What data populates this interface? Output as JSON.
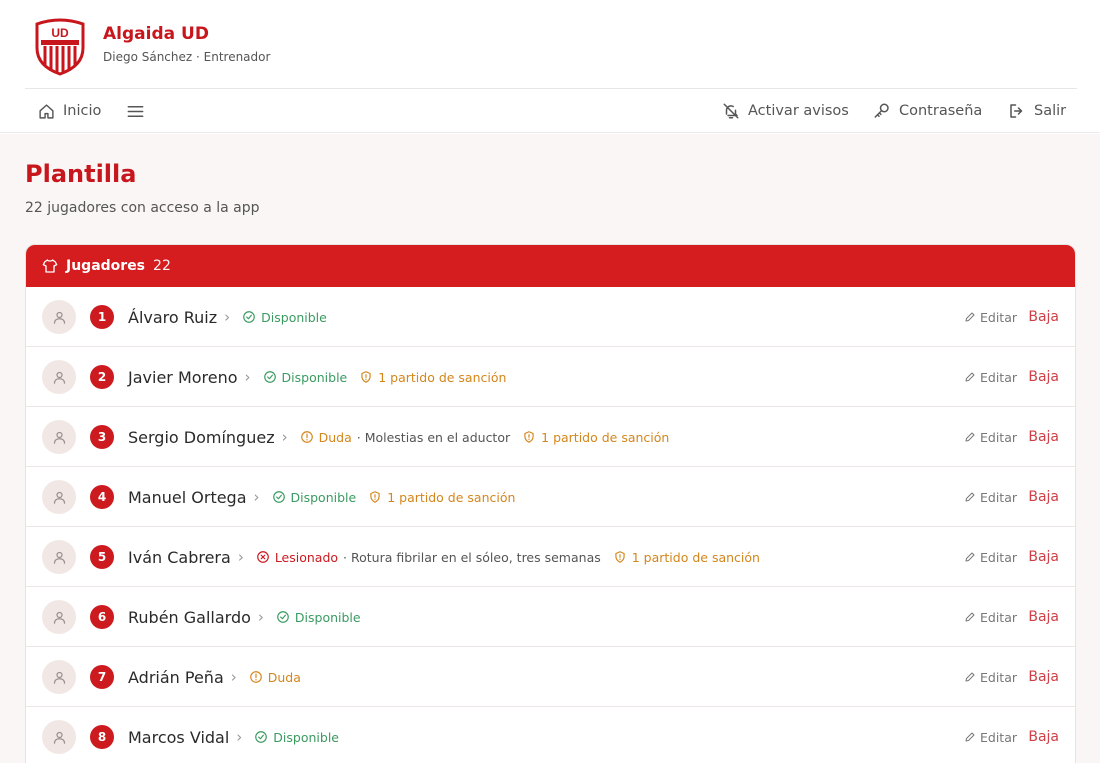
{
  "club": {
    "name": "Algaida UD",
    "subtitle": "Diego Sánchez · Entrenador",
    "crest_text": "UD"
  },
  "nav": {
    "home": "Inicio",
    "alerts": "Activar avisos",
    "password": "Contraseña",
    "logout": "Salir"
  },
  "page": {
    "title": "Plantilla",
    "subtitle": "22 jugadores con acceso a la app"
  },
  "panel": {
    "title": "Jugadores",
    "count": "22"
  },
  "actions": {
    "edit": "Editar",
    "remove": "Baja"
  },
  "colors": {
    "brand": "#c8161d",
    "ok": "#3a9a61",
    "warn": "#d4861c"
  },
  "players": [
    {
      "number": "1",
      "name": "Álvaro Ruiz",
      "tags": [
        {
          "kind": "ok",
          "icon": "check-circle-icon",
          "label": "Disponible"
        }
      ]
    },
    {
      "number": "2",
      "name": "Javier Moreno",
      "tags": [
        {
          "kind": "ok",
          "icon": "check-circle-icon",
          "label": "Disponible"
        },
        {
          "kind": "warn",
          "icon": "shield-icon",
          "label": "1 partido de sanción"
        }
      ]
    },
    {
      "number": "3",
      "name": "Sergio Domínguez",
      "tags": [
        {
          "kind": "warn",
          "icon": "alert-circle-icon",
          "label": "Duda",
          "note": " · Molestias en el aductor"
        },
        {
          "kind": "warn",
          "icon": "shield-icon",
          "label": "1 partido de sanción"
        }
      ]
    },
    {
      "number": "4",
      "name": "Manuel Ortega",
      "tags": [
        {
          "kind": "ok",
          "icon": "check-circle-icon",
          "label": "Disponible"
        },
        {
          "kind": "warn",
          "icon": "shield-icon",
          "label": "1 partido de sanción"
        }
      ]
    },
    {
      "number": "5",
      "name": "Iván Cabrera",
      "tags": [
        {
          "kind": "bad",
          "icon": "x-circle-icon",
          "label": "Lesionado",
          "note": " · Rotura fibrilar en el sóleo, tres semanas"
        },
        {
          "kind": "warn",
          "icon": "shield-icon",
          "label": "1 partido de sanción"
        }
      ]
    },
    {
      "number": "6",
      "name": "Rubén Gallardo",
      "tags": [
        {
          "kind": "ok",
          "icon": "check-circle-icon",
          "label": "Disponible"
        }
      ]
    },
    {
      "number": "7",
      "name": "Adrián Peña",
      "tags": [
        {
          "kind": "warn",
          "icon": "alert-circle-icon",
          "label": "Duda"
        }
      ]
    },
    {
      "number": "8",
      "name": "Marcos Vidal",
      "tags": [
        {
          "kind": "ok",
          "icon": "check-circle-icon",
          "label": "Disponible"
        }
      ]
    }
  ]
}
